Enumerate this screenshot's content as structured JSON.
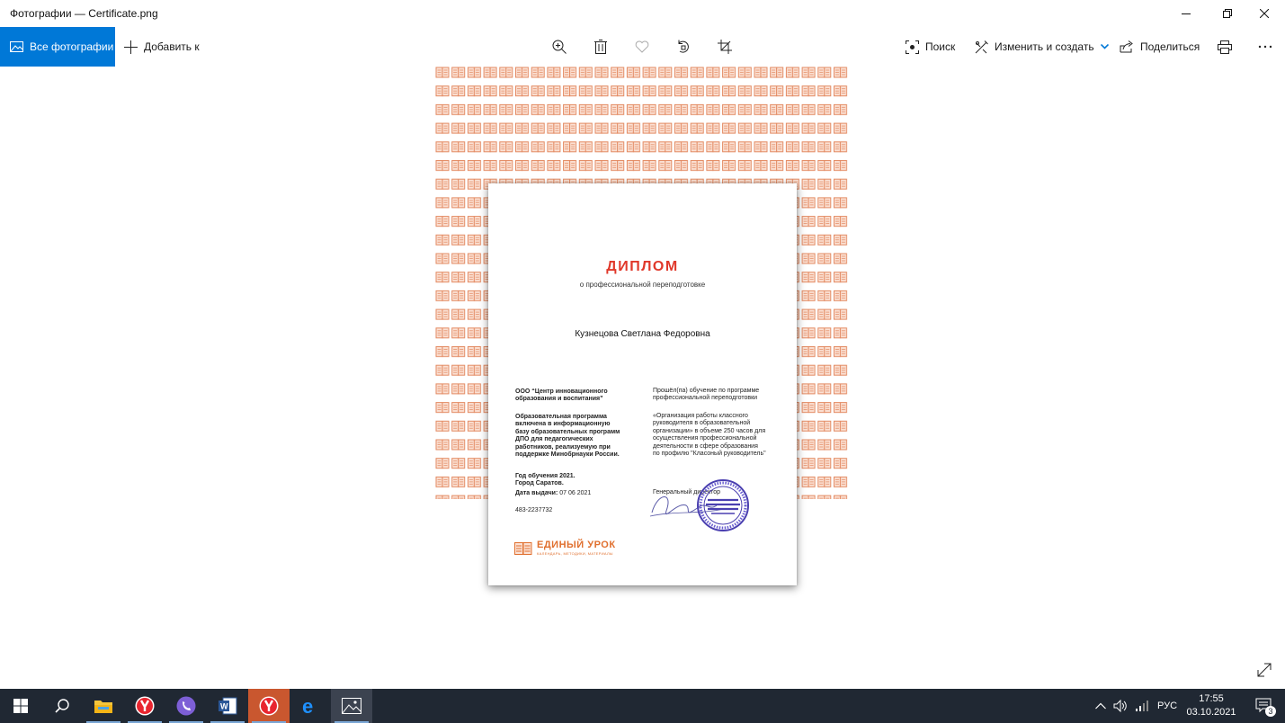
{
  "window": {
    "title": "Фотографии — Certificate.png",
    "minimize_icon": "minimize-icon",
    "maximize_icon": "restore-icon",
    "close_icon": "close-icon"
  },
  "toolbar": {
    "all_photos_label": "Все фотографии",
    "add_to_label": "Добавить к",
    "search_label": "Поиск",
    "edit_create_label": "Изменить и создать",
    "share_label": "Поделиться",
    "accent_color": "#0078d7"
  },
  "certificate": {
    "title": "ДИПЛОМ",
    "subtitle": "о профессиональной переподготовке",
    "recipient": "Кузнецова Светлана Федоровна",
    "org": "ООО “Центр инновационного\nобразования и воспитания”",
    "program_note": "Образовательная программа\nвключена в информационную\nбазу образовательных программ\nДПО для педагогических\nработников, реализуемую при\nподдержке Минобрнауки России.",
    "year_city": "Год обучения 2021.\nГород Саратов.",
    "issue_label": "Дата выдачи:",
    "issue_date": "07 06 2021",
    "number": "483-2237732",
    "completed": "Прошёл(па) обучение по программе\nпрофессиональной переподготовки",
    "program": "«Организация работы классного\nруководителя в образовательной\nорганизации» в объеме 250 часов для\nосуществления профессиональной\nдеятельности в сфере образования\nпо профилю \"Класоный руководитель\"",
    "director": "Генеральный директор",
    "logo_main": "ЕДИНЫЙ УРОК",
    "logo_sub": "КАЛЕНДАРЬ, МЕТОДИКИ, МАТЕРИАЛЫ",
    "title_color": "#e0382a",
    "logo_color": "#e0702f"
  },
  "taskbar": {
    "language": "РУС",
    "time": "17:55",
    "date": "03.10.2021",
    "notifications_count": "3"
  }
}
